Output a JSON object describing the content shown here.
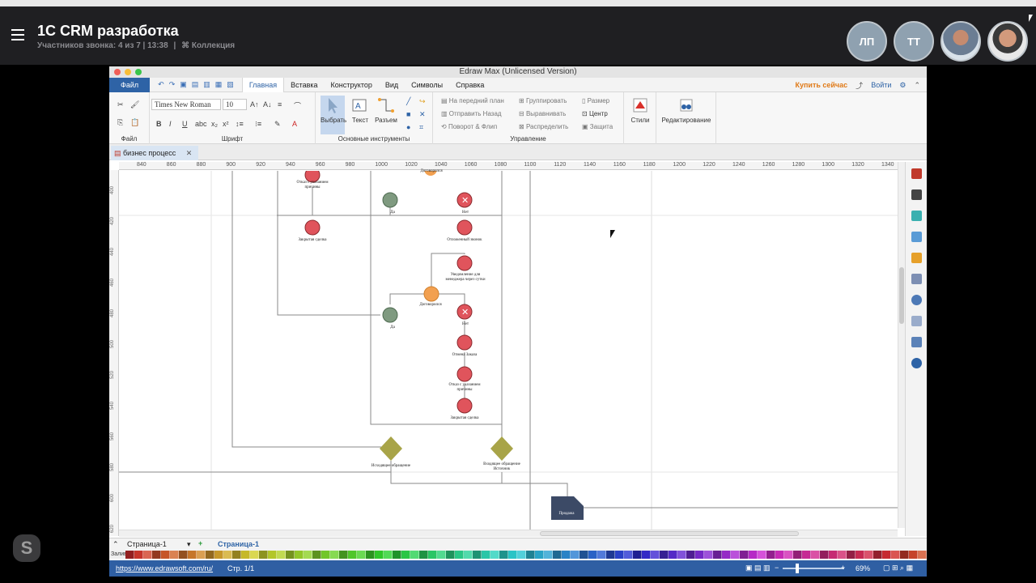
{
  "call": {
    "title": "1С CRM разработка",
    "participants": "Участников звонка: 4 из 7 | 13:38",
    "collection": "Коллекция",
    "avatars": [
      "ЛП",
      "ТТ"
    ]
  },
  "edraw": {
    "window_title": "Edraw Max (Unlicensed Version)",
    "menu_file": "Файл",
    "menu_tabs": [
      "Главная",
      "Вставка",
      "Конструктор",
      "Вид",
      "Символы",
      "Справка"
    ],
    "buy_now": "Купить сейчас",
    "login": "Войти",
    "ribbon": {
      "file_label": "Файл",
      "font_name": "Times New Roman",
      "font_size": "10",
      "font_label": "Шрифт",
      "select": "Выбрать",
      "text": "Текст",
      "connector": "Разъем",
      "basic_tools_label": "Основные инструменты",
      "bring_front": "На передний план",
      "send_back": "Отправить Назад",
      "rotate_flip": "Поворот & Флип",
      "group": "Группировать",
      "align": "Выравнивать",
      "distribute": "Распределить",
      "size": "Размер",
      "center": "Центр",
      "protect": "Защита",
      "manage_label": "Управление",
      "styles": "Стили",
      "editing": "Редактирование"
    },
    "doc_tab": "бизнес процесс",
    "ruler_h": [
      "840",
      "860",
      "880",
      "900",
      "920",
      "940",
      "960",
      "980",
      "1000",
      "1020",
      "1040",
      "1060",
      "1080",
      "1100",
      "1120",
      "1140",
      "1160",
      "1180",
      "1200",
      "1220",
      "1240",
      "1260",
      "1280",
      "1300",
      "1320",
      "1340"
    ],
    "ruler_v": [
      "400",
      "420",
      "440",
      "460",
      "480",
      "500",
      "520",
      "540",
      "560",
      "580",
      "600",
      "620"
    ],
    "diagram": {
      "labels": {
        "n1": "Отказ с указанием причины",
        "n2": "Договорился",
        "n3": "Да",
        "n4": "Нет",
        "n5": "Закрытая сделка",
        "n6": "Отложенный звонок",
        "n7": "Уведомление для менеджера через сутки",
        "n8": "Договорился",
        "n9": "Нет",
        "n10": "Да",
        "n11": "Отмена Заказа",
        "n12": "Отказ с указанием причины",
        "n13": "Закрытая сделка",
        "d1": "Исходящее обращение",
        "d2": "Входящее обращение Источник",
        "doc": "Продажа"
      }
    },
    "page_tab": "Страница-1",
    "page_tab_active": "Страница-1",
    "palette_label": "Залив",
    "status_link": "https://www.edrawsoft.com/ru/",
    "status_page": "Стр. 1/1",
    "zoom": "69%"
  },
  "colors": {
    "status_blue": "#2f5fa3",
    "node_red": "#e0545c",
    "node_green": "#7f9a80",
    "node_orange": "#f2a050",
    "diamond": "#a8a448",
    "doc_shape": "#3c4a66"
  }
}
